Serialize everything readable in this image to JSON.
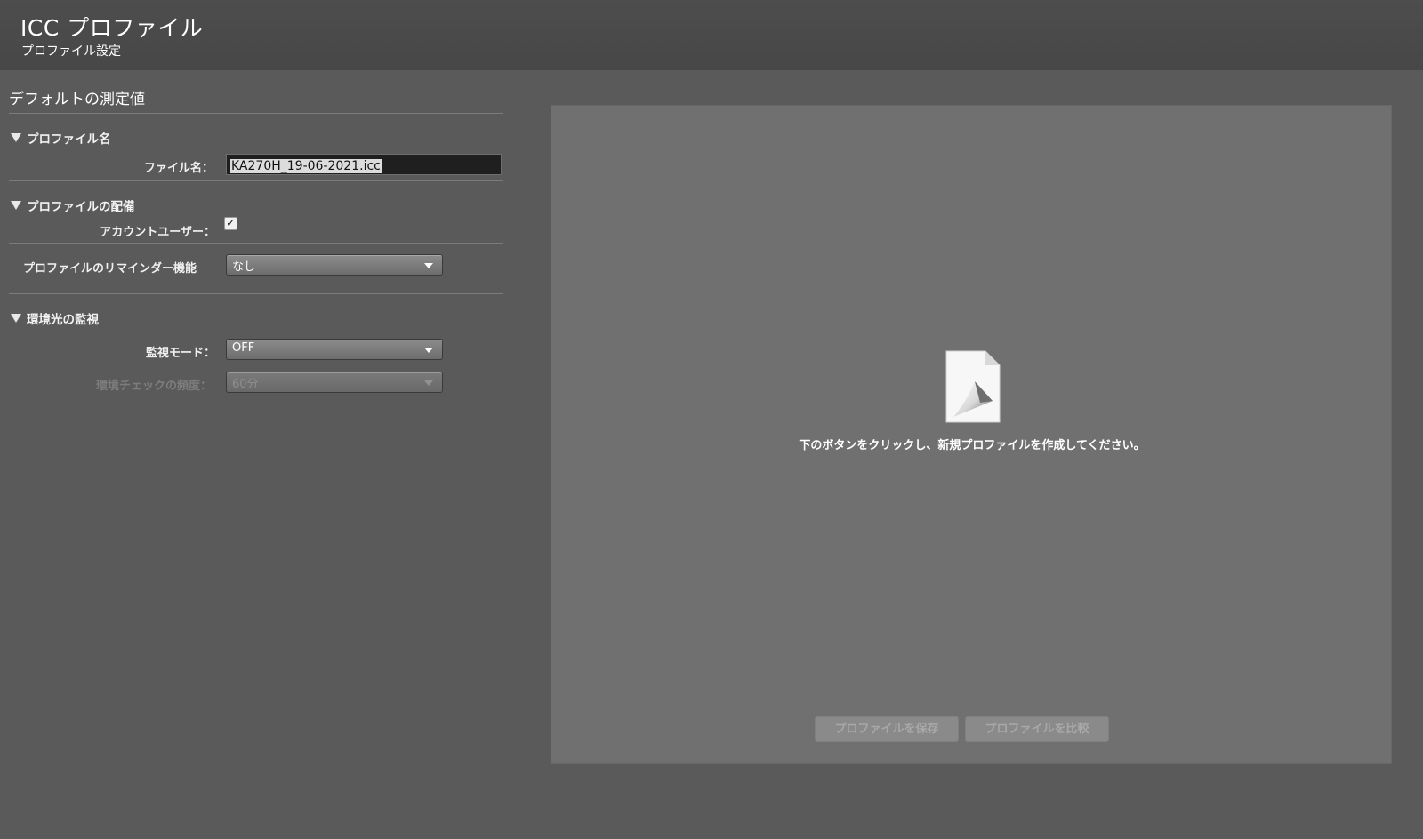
{
  "header": {
    "title": "ICC プロファイル",
    "subtitle": "プロファイル設定"
  },
  "left": {
    "section_title": "デフォルトの測定値",
    "profile_name": {
      "group_label": "プロファイル名",
      "file_label": "ファイル名：",
      "file_value": "KA270H_19-06-2021.icc"
    },
    "distribution": {
      "group_label": "プロファイルの配備",
      "account_user_label": "アカウントユーザー：",
      "account_user_checked": true,
      "reminder_label": "プロファイルのリマインダー機能",
      "reminder_value": "なし"
    },
    "ambient": {
      "group_label": "環境光の監視",
      "mode_label": "監視モード：",
      "mode_value": "OFF",
      "frequency_label": "環境チェックの頻度：",
      "frequency_value": "60分"
    }
  },
  "canvas": {
    "icon": "document-icon",
    "message": "下のボタンをクリックし、新規プロファイルを作成してください。",
    "save_button": "プロファイルを保存",
    "compare_button": "プロファイルを比較"
  },
  "colors": {
    "background": "#5a5a5a",
    "header": "#484848",
    "canvas": "#707070"
  }
}
